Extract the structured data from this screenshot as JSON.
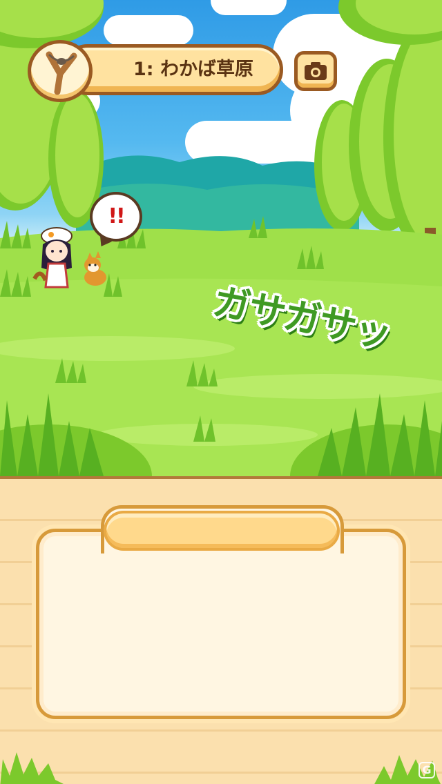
{
  "header": {
    "area_label": "1: わかば草原",
    "slingshot_icon": "slingshot-icon",
    "camera_icon": "camera-icon"
  },
  "scene": {
    "alert_text": "!!",
    "sfx_text": "ガサガサッ",
    "characters": [
      "girl-hunter",
      "shiba-dog"
    ]
  },
  "message_panel": {
    "title": "",
    "text": ""
  },
  "colors": {
    "sky": "#2f9be6",
    "grass": "#9fe04a",
    "wood": "#fbe0ae",
    "frame": "#d79a3a",
    "sfx": "#3f9a23",
    "alert": "#d01717"
  },
  "watermark": "G"
}
